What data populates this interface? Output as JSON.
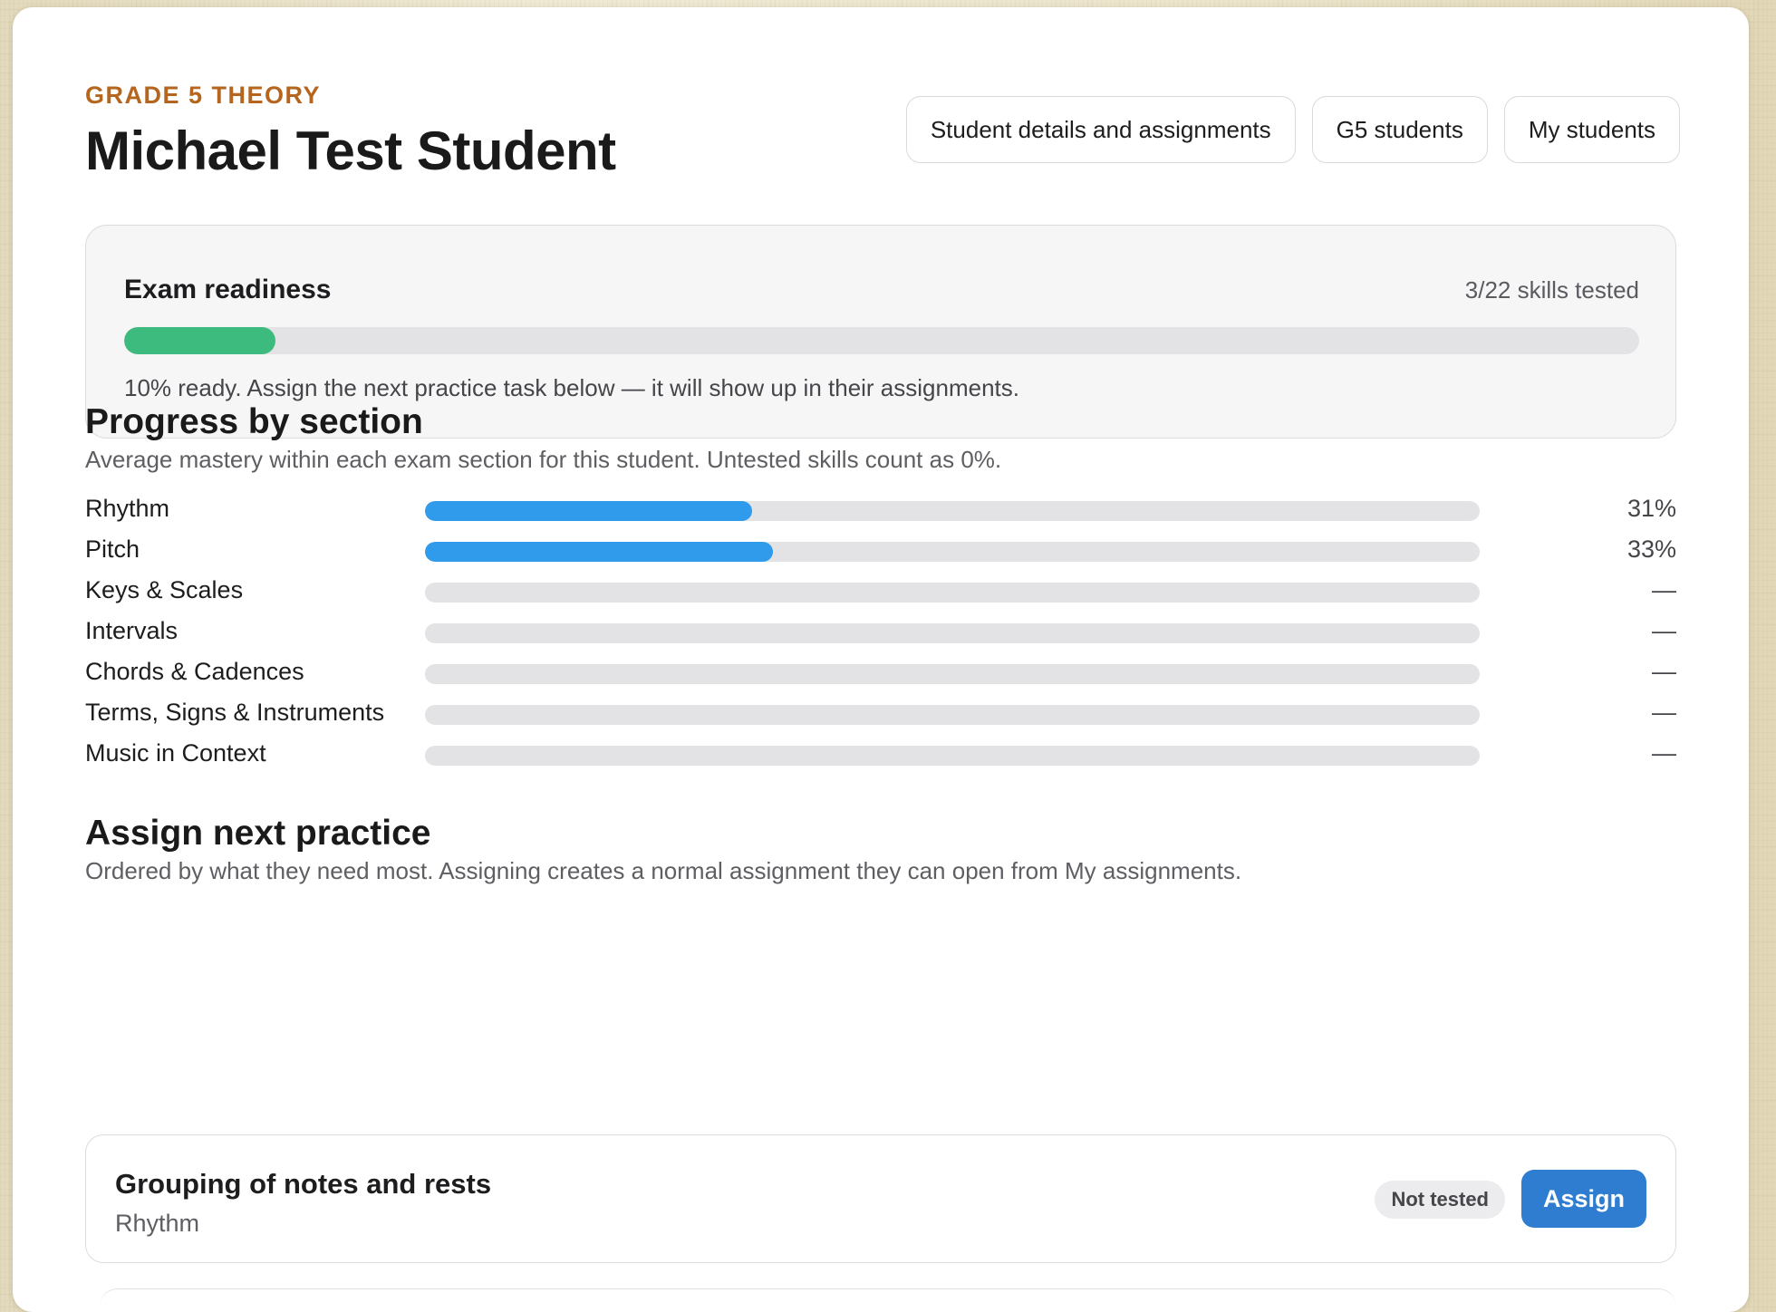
{
  "header": {
    "eyebrow": "GRADE 5 THEORY",
    "title": "Michael Test Student",
    "nav": [
      {
        "label": "Student details and assignments"
      },
      {
        "label": "G5 students"
      },
      {
        "label": "My students"
      }
    ]
  },
  "readiness": {
    "title": "Exam readiness",
    "skills_tested": "3/22 skills tested",
    "percent": 10,
    "message": "10% ready. Assign the next practice task below — it will show up in their assignments.",
    "color": "#3dbb7f"
  },
  "progress": {
    "title": "Progress by section",
    "subtitle": "Average mastery within each exam section for this student. Untested skills count as 0%.",
    "bar_color": "#2f9bea",
    "sections": [
      {
        "label": "Rhythm",
        "percent": 31,
        "value_text": "31%"
      },
      {
        "label": "Pitch",
        "percent": 33,
        "value_text": "33%"
      },
      {
        "label": "Keys & Scales",
        "percent": 0,
        "value_text": "—"
      },
      {
        "label": "Intervals",
        "percent": 0,
        "value_text": "—"
      },
      {
        "label": "Chords & Cadences",
        "percent": 0,
        "value_text": "—"
      },
      {
        "label": "Terms, Signs & Instruments",
        "percent": 0,
        "value_text": "—"
      },
      {
        "label": "Music in Context",
        "percent": 0,
        "value_text": "—"
      }
    ]
  },
  "assign": {
    "title": "Assign next practice",
    "subtitle": "Ordered by what they need most. Assigning creates a normal assignment they can open from My assignments.",
    "tasks": [
      {
        "title": "Grouping of notes and rests",
        "section": "Rhythm",
        "status": "Not tested",
        "button": "Assign"
      }
    ]
  }
}
